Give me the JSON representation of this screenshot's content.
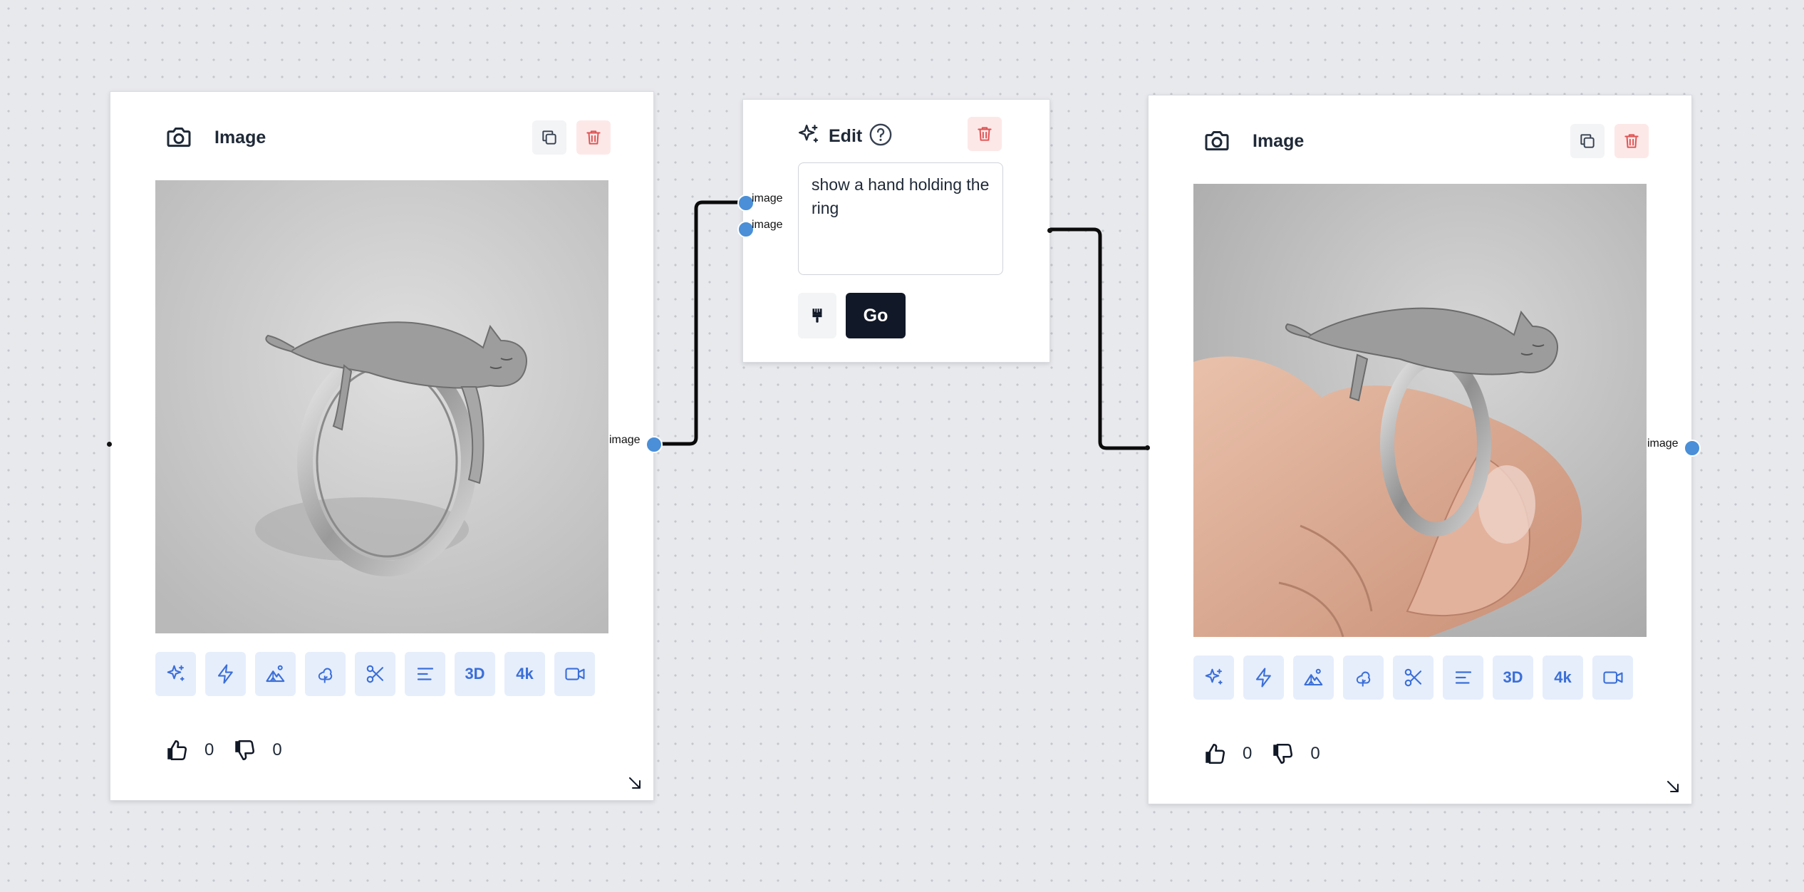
{
  "left_node": {
    "title": "Image",
    "output_port_label": "image",
    "toolbar": [
      {
        "icon": "sparkles-icon",
        "label": ""
      },
      {
        "icon": "lightning-icon",
        "label": ""
      },
      {
        "icon": "landscape-icon",
        "label": ""
      },
      {
        "icon": "trees-icon",
        "label": ""
      },
      {
        "icon": "scissors-icon",
        "label": ""
      },
      {
        "icon": "align-left-icon",
        "label": ""
      },
      {
        "icon": "",
        "label": "3D"
      },
      {
        "icon": "",
        "label": "4k"
      },
      {
        "icon": "video-icon",
        "label": ""
      }
    ],
    "likes": "0",
    "dislikes": "0"
  },
  "edit_node": {
    "title": "Edit",
    "input_ports": [
      "image",
      "image"
    ],
    "prompt": "show a hand holding the ring",
    "go_label": "Go"
  },
  "right_node": {
    "title": "Image",
    "output_port_label": "image",
    "toolbar": [
      {
        "icon": "sparkles-icon",
        "label": ""
      },
      {
        "icon": "lightning-icon",
        "label": ""
      },
      {
        "icon": "landscape-icon",
        "label": ""
      },
      {
        "icon": "trees-icon",
        "label": ""
      },
      {
        "icon": "scissors-icon",
        "label": ""
      },
      {
        "icon": "align-left-icon",
        "label": ""
      },
      {
        "icon": "",
        "label": "3D"
      },
      {
        "icon": "",
        "label": "4k"
      },
      {
        "icon": "video-icon",
        "label": ""
      }
    ],
    "likes": "0",
    "dislikes": "0"
  },
  "colors": {
    "canvas": "#e8e9ed",
    "accent": "#4a8fd8",
    "tool_bg": "#e6eefc",
    "tool_fg": "#3b6fd8",
    "danger": "#e05252",
    "go_bg": "#111827"
  }
}
